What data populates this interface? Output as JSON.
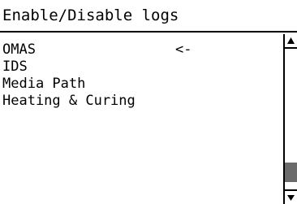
{
  "header": {
    "title": "Enable/Disable logs"
  },
  "menu": {
    "items": [
      {
        "label": "OMAS"
      },
      {
        "label": "IDS"
      },
      {
        "label": "Media Path"
      },
      {
        "label": "Heating & Curing"
      }
    ],
    "selected_marker": "<-"
  },
  "scrollbar": {
    "up_icon": "up-arrow-icon",
    "down_icon": "down-arrow-icon",
    "thumb_start_fraction": 0.81,
    "thumb_end_fraction": 0.95,
    "thumb_color": "#6b6b6b"
  },
  "colors": {
    "background": "#ffffff",
    "foreground": "#000000"
  }
}
